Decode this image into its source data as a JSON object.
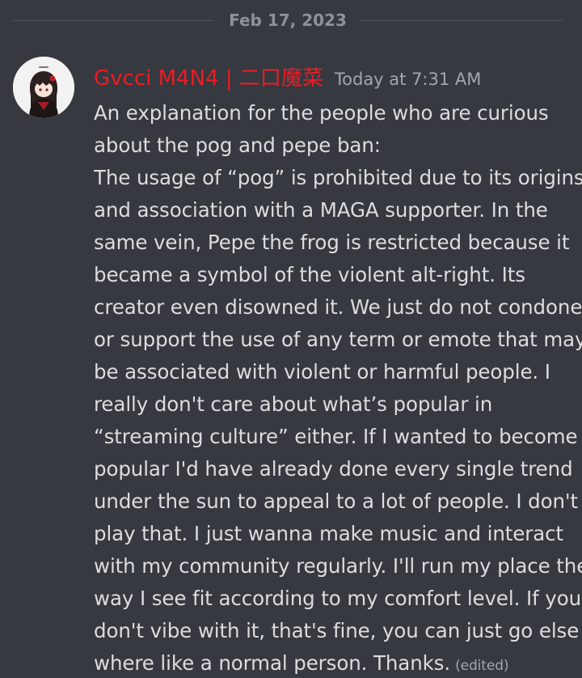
{
  "divider": {
    "date": "Feb 17, 2023"
  },
  "message": {
    "author": "Gvcci M4N4 | 二口魔菜",
    "author_color": "#ed1c24",
    "timestamp": "Today at 7:31 AM",
    "lines": [
      "An explanation for the people who are curious",
      "about the pog and pepe ban:",
      "The usage of “pog” is prohibited due to its origins",
      "and association with a MAGA supporter. In the",
      "same vein, Pepe the frog is restricted because it",
      "became a symbol of the violent alt-right. Its",
      "creator even disowned it. We just do not condone",
      "or support the use of any term or emote that may",
      "be associated with violent or harmful people. I",
      "really don't care about what’s popular in",
      "“streaming culture” either. If I wanted to become",
      "popular I'd have already done every single trend",
      "under the sun to appeal to a lot of people. I don't",
      "play that. I just wanna make music and interact",
      "with my community regularly. I'll run my place the",
      "way I see fit according to my comfort level. If you",
      "don't vibe with it, that's fine, you can just go else",
      "where like a normal person. Thanks."
    ],
    "edited_label": "(edited)"
  }
}
